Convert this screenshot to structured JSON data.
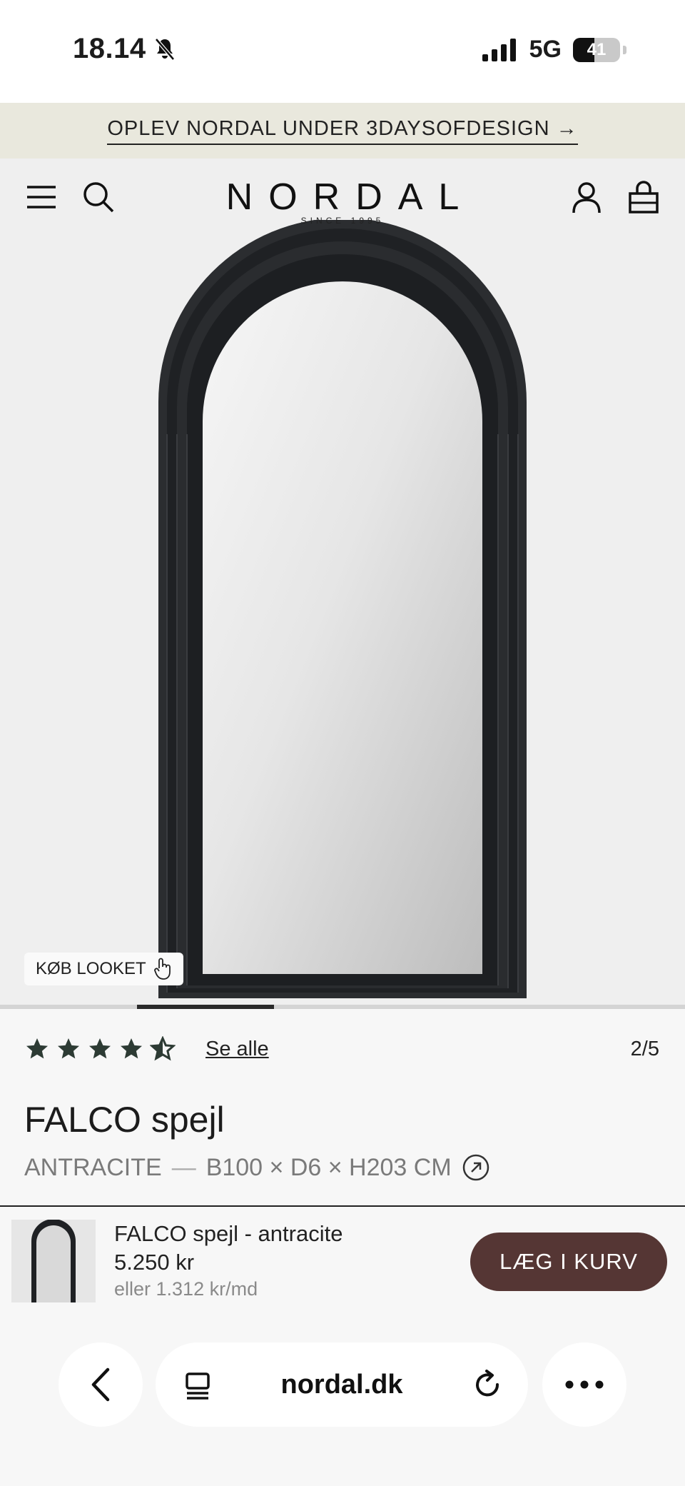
{
  "status_bar": {
    "time": "18.14",
    "network": "5G",
    "battery": "41"
  },
  "promo": {
    "text": "OPLEV NORDAL UNDER 3DAYSOFDESIGN →"
  },
  "header": {
    "logo": "NORDAL",
    "logo_tagline": "SINCE 1995"
  },
  "hero": {
    "look_button": "KØB LOOKET",
    "gallery_progress": 0.4
  },
  "product": {
    "rating_stars": 4.5,
    "see_all": "Se alle",
    "pager": "2/5",
    "title": "FALCO spejl",
    "color": "ANTRACITE",
    "separator": "—",
    "dimensions": "B100 × D6 × H203 CM"
  },
  "cart": {
    "name": "FALCO spejl - antracite",
    "price": "5.250 kr",
    "monthly": "eller 1.312 kr/md",
    "button": "LÆG I KURV"
  },
  "browser": {
    "url": "nordal.dk"
  },
  "colors": {
    "brand_button": "#553634",
    "promo_bg": "#e9e8dd",
    "star": "#2d3b34"
  }
}
